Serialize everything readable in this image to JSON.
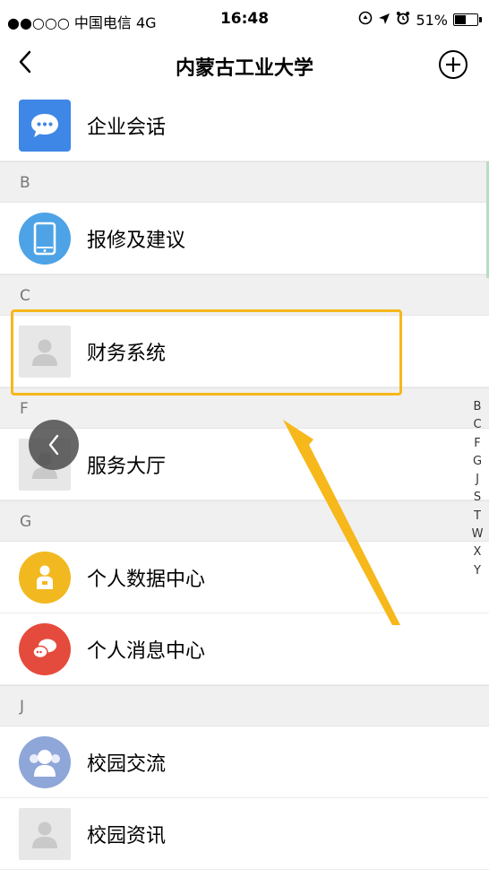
{
  "status_bar": {
    "carrier": "●●○○○ 中国电信 4G",
    "time": "16:48",
    "battery": "51%",
    "battery_level": 0.51
  },
  "nav": {
    "back_icon": "chevron-left-icon",
    "title": "内蒙古工业大学",
    "add_icon": "plus-circle-icon"
  },
  "list": {
    "top_item": "企业会话",
    "sections": [
      {
        "letter": "B",
        "items": [
          "报修及建议"
        ]
      },
      {
        "letter": "C",
        "items": [
          "财务系统"
        ]
      },
      {
        "letter": "F",
        "items": [
          "服务大厅"
        ]
      },
      {
        "letter": "G",
        "items": [
          "个人数据中心",
          "个人消息中心"
        ]
      },
      {
        "letter": "J",
        "items": [
          "校园交流",
          "校园资讯"
        ]
      }
    ]
  },
  "index_bar": [
    "B",
    "C",
    "F",
    "G",
    "J",
    "S",
    "T",
    "W",
    "X",
    "Y"
  ],
  "colors": {
    "highlight": "#f6b81a",
    "chat_icon": "#3f87e6",
    "tablet_icon": "#4da3e6",
    "data_icon": "#f2b820",
    "message_icon": "#e54b3c",
    "exchange_icon": "#8fa6d8"
  }
}
